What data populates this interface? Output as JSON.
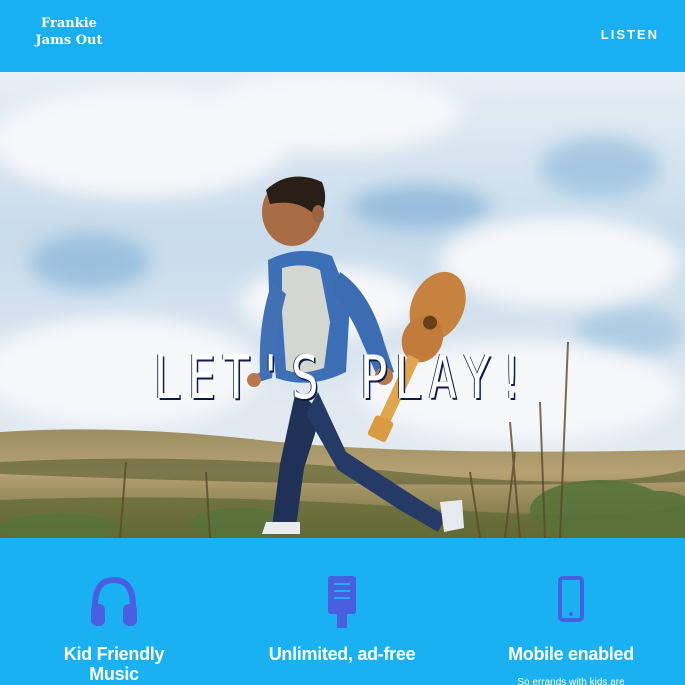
{
  "header": {
    "logo_line1": "Frankie",
    "logo_line2": "Jams Out",
    "nav_listen": "LISTEN"
  },
  "hero": {
    "title": "LET'S PLAY!"
  },
  "features": [
    {
      "icon": "headphones-icon",
      "title": "Kid Friendly Music",
      "description": ""
    },
    {
      "icon": "microphone-icon",
      "title": "Unlimited, ad-free",
      "description": ""
    },
    {
      "icon": "mobile-phone-icon",
      "title": "Mobile enabled",
      "description": "So errands with kids are"
    }
  ],
  "colors": {
    "header_bg": "#18aff3",
    "section_bg": "#1ab1f3",
    "icon_color": "#4a5fe0",
    "text": "#ffffff"
  }
}
